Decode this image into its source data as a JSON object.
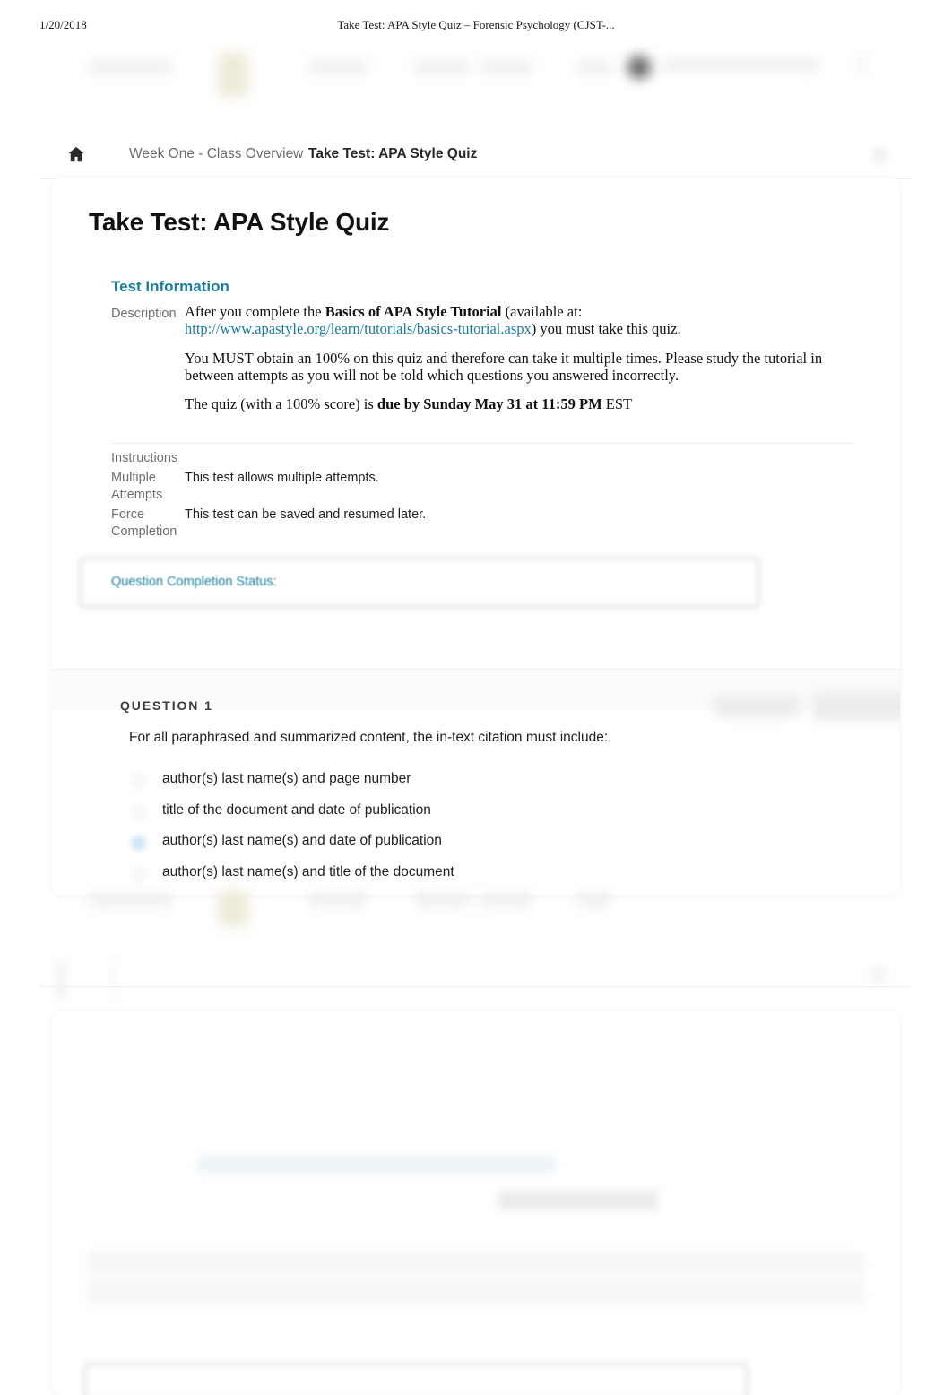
{
  "print_header": {
    "date": "1/20/2018",
    "title": "Take Test: APA Style Quiz – Forensic Psychology (CJST-..."
  },
  "breadcrumb": {
    "home_icon": "home-icon",
    "parent": "Week One - Class Overview",
    "current": "Take Test: APA Style Quiz"
  },
  "page": {
    "title": "Take Test: APA Style Quiz"
  },
  "test_information": {
    "heading": "Test Information",
    "description_label": "Description",
    "description": {
      "p1_a": "After you complete the ",
      "p1_bold": "Basics of APA Style Tutorial",
      "p1_b": " (available at: ",
      "p1_link": "http://www.apastyle.org/learn/tutorials/basics-tutorial.aspx",
      "p1_c": ") you must take this quiz.",
      "p2": "You MUST obtain an 100% on this quiz and therefore can take it multiple times. Please study the tutorial in between attempts as you will not be told which questions you answered incorrectly.",
      "p3_a": "The quiz (with a 100% score) is ",
      "p3_bold": "due by Sunday May 31 at 11:59 PM",
      "p3_b": " EST"
    },
    "instructions_label": "Instructions",
    "rows": [
      {
        "label": "Multiple Attempts",
        "value": "This test allows multiple attempts."
      },
      {
        "label": "Force Completion",
        "value": "This test can be saved and resumed later."
      }
    ]
  },
  "question_completion_status": {
    "link_label": "Question Completion Status:"
  },
  "question": {
    "number_label": "QUESTION 1",
    "text": "For all paraphrased and summarized content, the in-text citation must include:",
    "options": [
      {
        "label": "author(s) last name(s) and page number",
        "selected": false
      },
      {
        "label": "title of the document and date of publication",
        "selected": false
      },
      {
        "label": "author(s) last name(s) and date of publication",
        "selected": true
      },
      {
        "label": "author(s) last name(s) and title of the document",
        "selected": false
      }
    ]
  },
  "colors": {
    "accent_teal": "#1a7d9c",
    "text_primary": "#1f1f1f",
    "text_muted": "#6f6f6f",
    "selected_radio": "#bfe0f3"
  }
}
